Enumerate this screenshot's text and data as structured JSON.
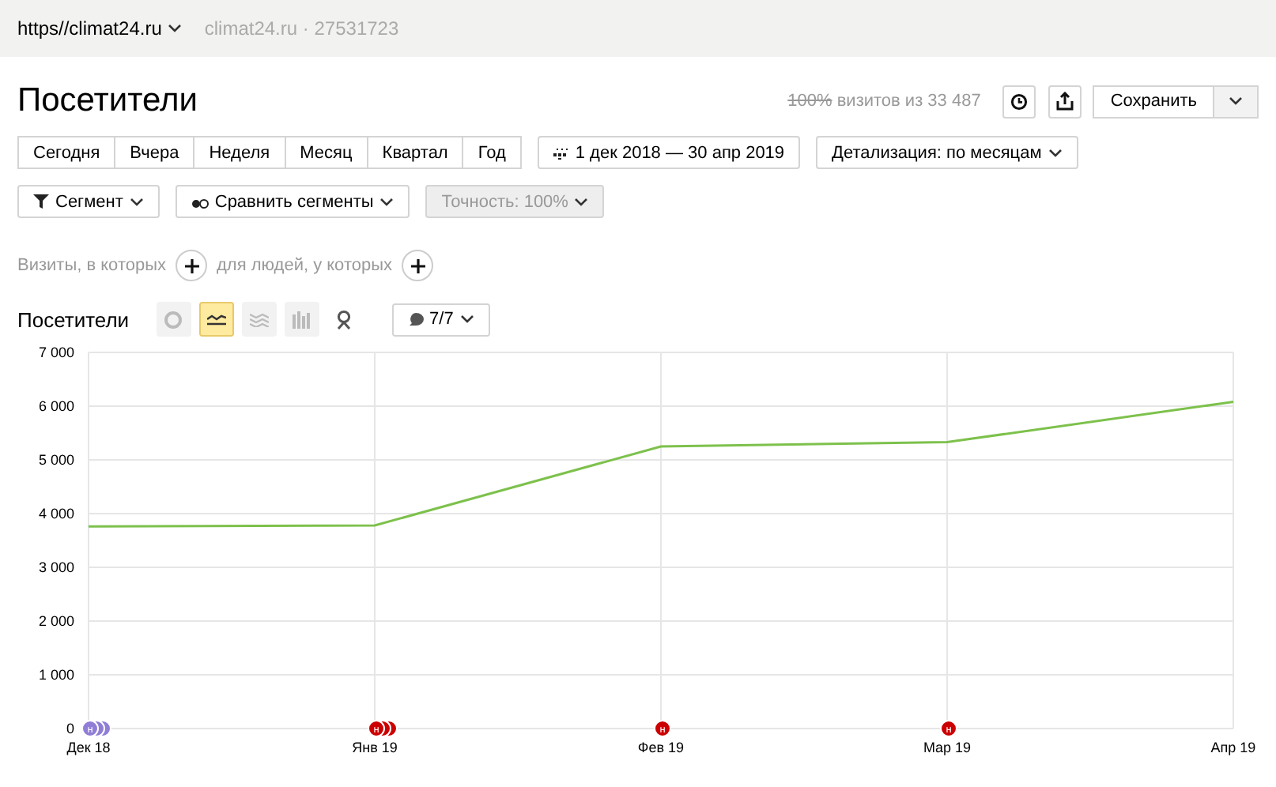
{
  "header": {
    "site": "https//climat24.ru",
    "counter_name": "climat24.ru",
    "separator": "·",
    "counter_id": "27531723"
  },
  "title": "Посетители",
  "sampling": {
    "percent": "100%",
    "text": "визитов из 33 487"
  },
  "save_button": "Сохранить",
  "periods": [
    {
      "label": "Сегодня",
      "selected": false
    },
    {
      "label": "Вчера",
      "selected": false
    },
    {
      "label": "Неделя",
      "selected": false
    },
    {
      "label": "Месяц",
      "selected": false
    },
    {
      "label": "Квартал",
      "selected": false
    },
    {
      "label": "Год",
      "selected": false
    }
  ],
  "date_range": "1 дек 2018 — 30 апр 2019",
  "detail": "Детализация: по месяцам",
  "segment_button": "Сегмент",
  "compare_button": "Сравнить сегменты",
  "accuracy": {
    "label": "Точность: 100%",
    "disabled": true
  },
  "filters": [
    "Визиты, в которых",
    "для людей, у которых"
  ],
  "chart_header": {
    "title": "Посетители",
    "chart_types": [
      {
        "kind": "pie",
        "selected": false
      },
      {
        "kind": "line",
        "selected": true
      },
      {
        "kind": "area",
        "selected": false
      },
      {
        "kind": "bar",
        "selected": false
      },
      {
        "kind": "map",
        "selected": false
      }
    ],
    "notes_count": "7/7"
  },
  "chart": {
    "chart_data": {
      "type": "line",
      "categories": [
        "Дек 18",
        "Янв 19",
        "Фев 19",
        "Мар 19",
        "Апр 19"
      ],
      "grid": true,
      "series": [
        {
          "color": "#7dc14c",
          "values": [
            3760,
            3780,
            5250,
            5330,
            6080
          ]
        }
      ],
      "ylim": [
        0,
        7000
      ],
      "yticks": [
        {
          "value": 0,
          "label": "0"
        },
        {
          "value": 1000,
          "label": "1 000"
        },
        {
          "value": 2000,
          "label": "2 000"
        },
        {
          "value": 3000,
          "label": "3 000"
        },
        {
          "value": 4000,
          "label": "4 000"
        },
        {
          "value": 5000,
          "label": "5 000"
        },
        {
          "value": 6000,
          "label": "6 000"
        },
        {
          "value": 7000,
          "label": "7 000"
        }
      ]
    },
    "notes": [
      {
        "kind": "stack",
        "letter": "н",
        "color": "#8f7dd6"
      },
      {
        "kind": "stack",
        "letter": "н",
        "color": "#cc0000"
      },
      {
        "kind": "single",
        "letter": "н",
        "color": "#cc0000"
      },
      {
        "kind": "single",
        "letter": "н",
        "color": "#cc0000"
      }
    ]
  }
}
